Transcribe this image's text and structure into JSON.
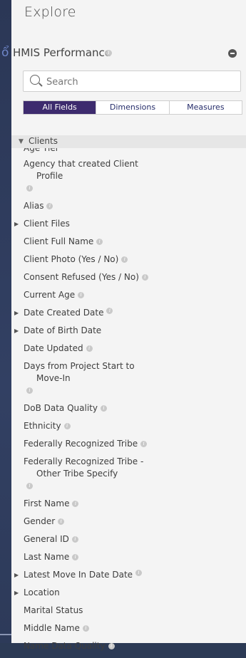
{
  "header": {
    "title": "Explore"
  },
  "model": {
    "name": "HMIS Performance"
  },
  "search": {
    "placeholder": "Search"
  },
  "tabs": [
    {
      "label": "All Fields",
      "active": true
    },
    {
      "label": "Dimensions",
      "active": false
    },
    {
      "label": "Measures",
      "active": false
    }
  ],
  "group": {
    "label": "Clients",
    "partial_label": "Age Tier"
  },
  "fields": [
    {
      "lines": [
        "Agency that created Client",
        "Profile"
      ],
      "info": true,
      "expandable": false
    },
    {
      "lines": [
        "Alias"
      ],
      "info": true,
      "expandable": false
    },
    {
      "lines": [
        "Client Files"
      ],
      "info": false,
      "expandable": true
    },
    {
      "lines": [
        "Client Full Name"
      ],
      "info": true,
      "expandable": false
    },
    {
      "lines": [
        "Client Photo (Yes / No)"
      ],
      "info": true,
      "expandable": false
    },
    {
      "lines": [
        "Consent Refused (Yes / No)"
      ],
      "info": true,
      "expandable": false
    },
    {
      "lines": [
        "Current Age"
      ],
      "info": true,
      "expandable": false
    },
    {
      "lines": [
        "Date Created Date"
      ],
      "info": true,
      "expandable": true
    },
    {
      "lines": [
        "Date of Birth Date"
      ],
      "info": false,
      "expandable": true
    },
    {
      "lines": [
        "Date Updated"
      ],
      "info": true,
      "expandable": false
    },
    {
      "lines": [
        "Days from Project Start to",
        "Move-In"
      ],
      "info": true,
      "expandable": false
    },
    {
      "lines": [
        "DoB Data Quality"
      ],
      "info": true,
      "expandable": false
    },
    {
      "lines": [
        "Ethnicity"
      ],
      "info": true,
      "expandable": false
    },
    {
      "lines": [
        "Federally Recognized Tribe"
      ],
      "info": true,
      "expandable": false
    },
    {
      "lines": [
        "Federally Recognized Tribe -",
        "Other Tribe Specify"
      ],
      "info": true,
      "expandable": false
    },
    {
      "lines": [
        "First Name"
      ],
      "info": true,
      "expandable": false
    },
    {
      "lines": [
        "Gender"
      ],
      "info": true,
      "expandable": false
    },
    {
      "lines": [
        "General ID"
      ],
      "info": true,
      "expandable": false
    },
    {
      "lines": [
        "Last Name"
      ],
      "info": true,
      "expandable": false
    },
    {
      "lines": [
        "Latest Move In Date Date"
      ],
      "info": true,
      "expandable": true
    },
    {
      "lines": [
        "Location"
      ],
      "info": false,
      "expandable": true
    },
    {
      "lines": [
        "Marital Status"
      ],
      "info": false,
      "expandable": false
    },
    {
      "lines": [
        "Middle Name"
      ],
      "info": true,
      "expandable": false
    },
    {
      "lines": [
        "Name Data Quality"
      ],
      "info": true,
      "expandable": false
    }
  ]
}
